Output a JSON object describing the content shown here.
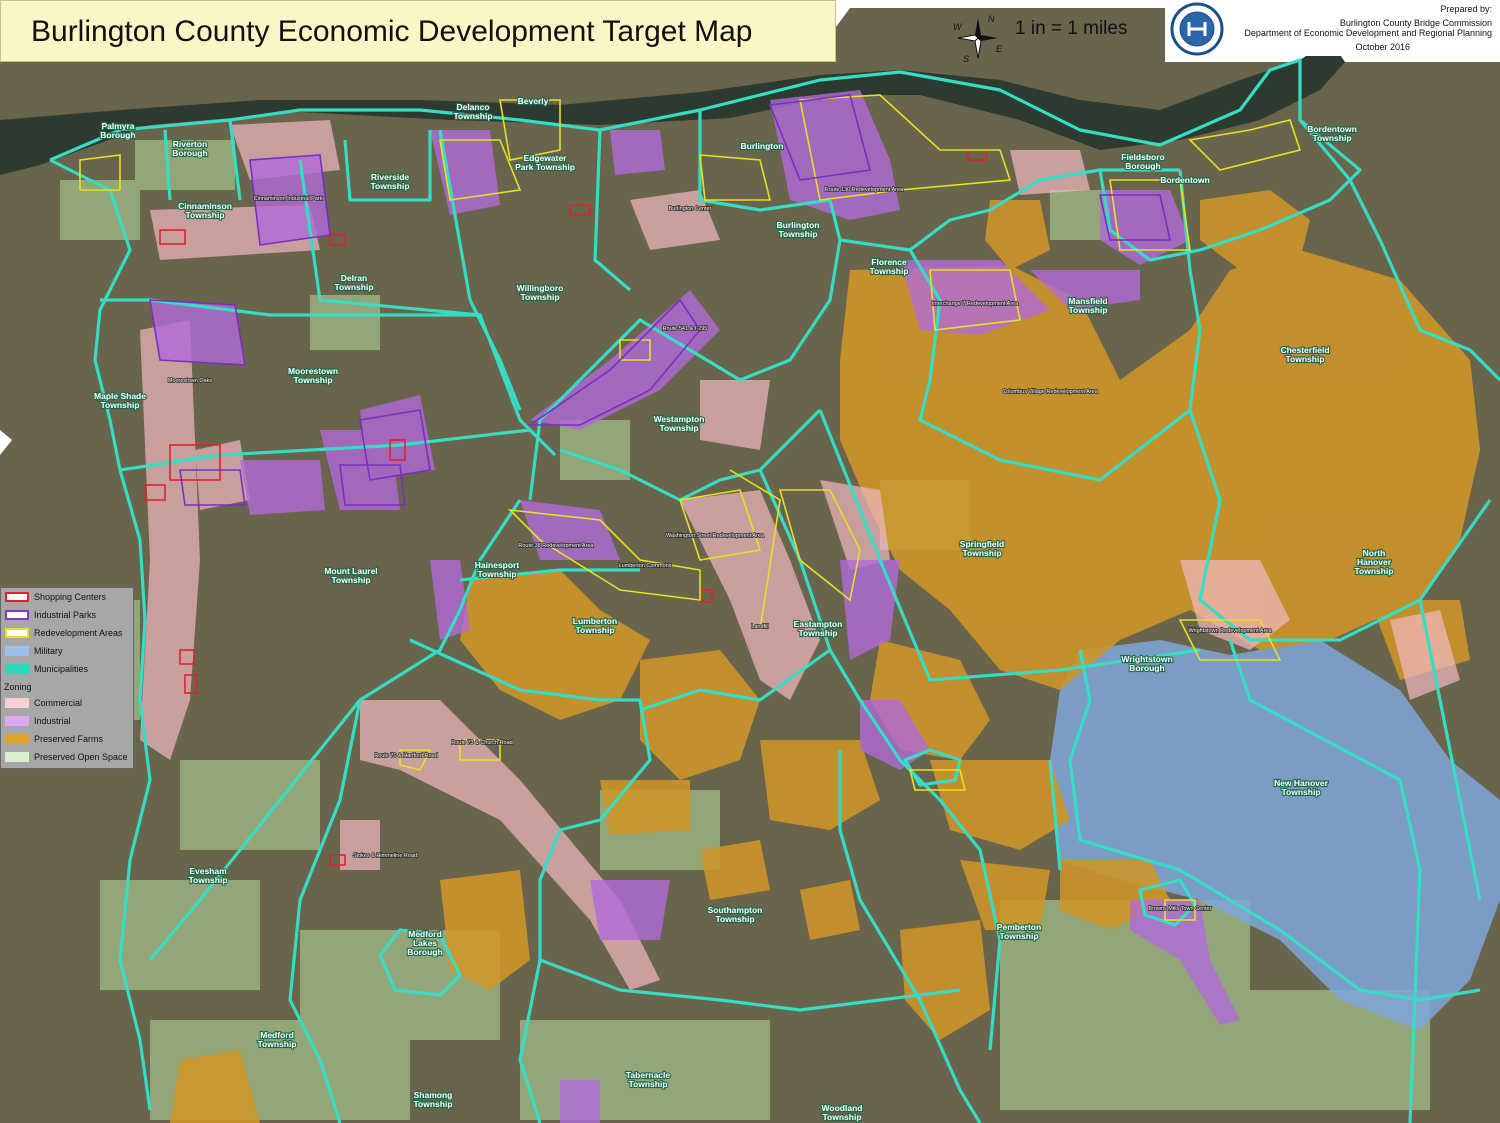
{
  "title": "Burlington County  Economic Development Target Map",
  "scale": "1 in = 1 miles",
  "compass": {
    "icon": "compass-rose-icon",
    "n": "N",
    "s": "S",
    "e": "E",
    "w": "W"
  },
  "credit": {
    "line1": "Prepared by:",
    "line2": "Burlington County Bridge Commission",
    "line3": "Department of Economic Development and Regional Planning",
    "line4": "October 2016",
    "seal_icon": "county-seal-icon"
  },
  "legend": {
    "items": [
      {
        "label": "Shopping Centers",
        "fill": "#ffffff",
        "stroke": "#e0222c"
      },
      {
        "label": "Industrial Parks",
        "fill": "#ffffff",
        "stroke": "#8a35c8"
      },
      {
        "label": "Redevelopment Areas",
        "fill": "#ffffff",
        "stroke": "#e8e020"
      },
      {
        "label": "Military",
        "fill": "#9cc0ea",
        "stroke": "#9cc0ea"
      },
      {
        "label": "Municipalities",
        "fill": "#2fd6b9",
        "stroke": "#2fd6b9"
      }
    ],
    "zoning_heading": "Zoning",
    "zoning": [
      {
        "label": "Commercial",
        "fill": "#f6cfd3"
      },
      {
        "label": "Industrial",
        "fill": "#dca8ef"
      },
      {
        "label": "Preserved Farms",
        "fill": "#e0a22a"
      },
      {
        "label": "Preserved Open Space",
        "fill": "#d7f0cf"
      }
    ]
  },
  "colors": {
    "aerial": "#69644c",
    "river": "#2f3a30",
    "boundary": "#36dcc4",
    "commercial": "#f2b9c2",
    "industrial": "#b26ad8",
    "farms": "#cf9628",
    "open_space": "#b6dc9c",
    "military": "#7fa6d9"
  },
  "municipalities": [
    "Palmyra Borough",
    "Riverton Borough",
    "Cinnaminson Township",
    "Riverside Township",
    "Delanco Township",
    "Beverly",
    "Edgewater Park Township",
    "Burlington",
    "Burlington Township",
    "Florence Township",
    "Fieldsboro Borough",
    "Bordentown",
    "Bordentown Township",
    "Delran Township",
    "Willingboro Township",
    "Moorestown Township",
    "Maple Shade Township",
    "Mansfield Township",
    "Chesterfield Township",
    "Westampton Township",
    "Springfield Township",
    "Hainesport Township",
    "Mount Laurel Township",
    "Lumberton Township",
    "Eastampton Township",
    "Wrightstown Borough",
    "North Hanover Township",
    "New Hanover Township",
    "Evesham Township",
    "Southampton Township",
    "Pemberton Township",
    "Medford Lakes Borough",
    "Medford Township",
    "Tabernacle Township",
    "Shamong Township",
    "Woodland Township"
  ],
  "sites": [
    "Cinnaminson Industrial Park",
    "Moorestown Oaks",
    "Route 38 Redevelopment Area",
    "Washington Street Redevelopment Area",
    "Interchange 7 Redevelopment Area",
    "Wrightstown Redevelopment Area",
    "Route 70 & Hartford Road",
    "Route 73 & Church Road",
    "Burlington Center",
    "Route 130 Redevelopment Area",
    "Lumberton Commons",
    "Landfill",
    "Columbus Village Redevelopment Area",
    "Route 541 & I-295",
    "Stokes & Himmeline Road",
    "Browns Mills Town Center"
  ]
}
